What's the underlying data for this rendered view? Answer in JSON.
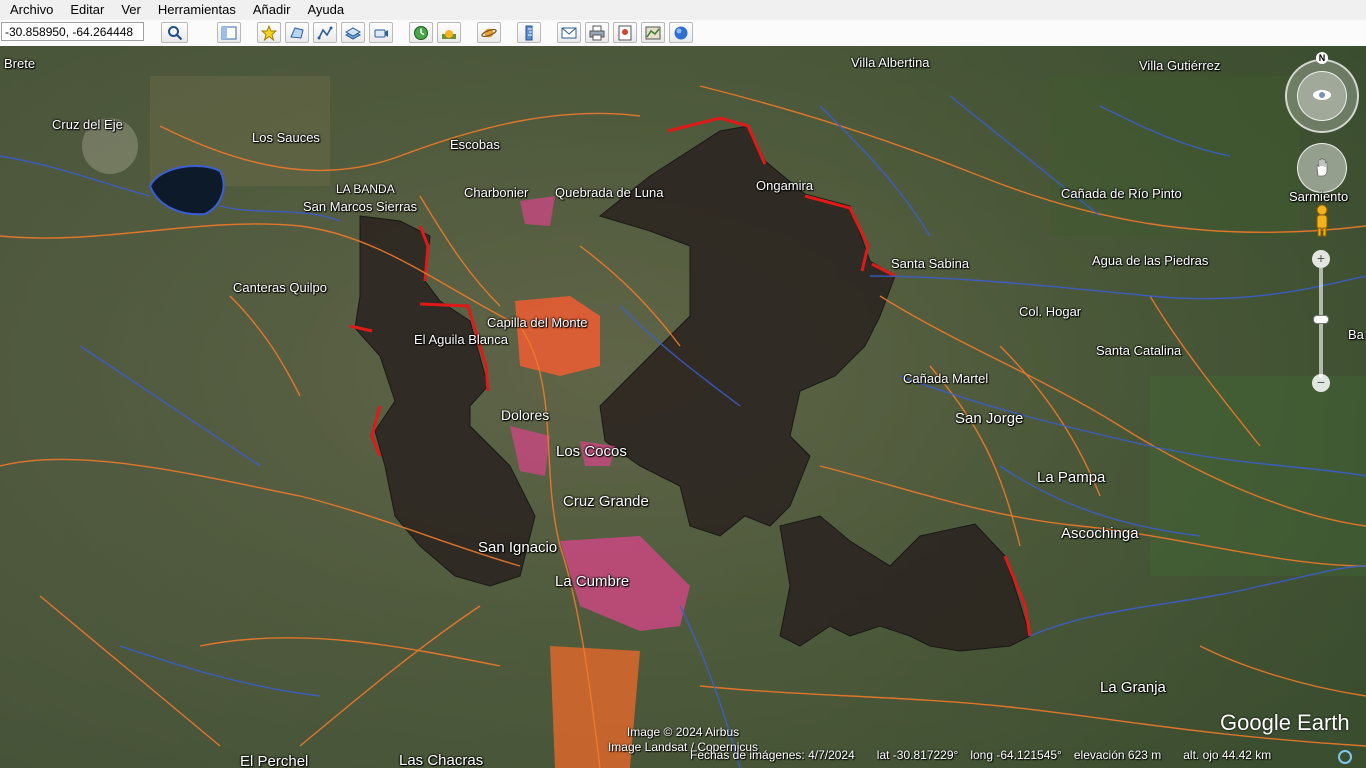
{
  "menu": [
    "Archivo",
    "Editar",
    "Ver",
    "Herramientas",
    "Añadir",
    "Ayuda"
  ],
  "search": {
    "value": "-30.858950, -64.264448"
  },
  "toolbar_icons": [
    "search-icon",
    "sidebar-toggle-icon",
    "placemark-icon",
    "polygon-icon",
    "path-icon",
    "overlay-icon",
    "tour-icon",
    "historical-imagery-icon",
    "sun-icon",
    "planets-icon",
    "ruler-icon",
    "email-icon",
    "print-icon",
    "save-image-icon",
    "google-maps-icon"
  ],
  "map_labels": {
    "brete": "Brete",
    "cruz_del_eje": "Cruz del Eje",
    "los_sauces": "Los Sauces",
    "escobas": "Escobas",
    "villa_albertina": "Villa Albertina",
    "villa_gutierrez": "Villa Gutiérrez",
    "la_banda": "LA BANDA",
    "san_marcos": "San Marcos Sierras",
    "charbonier": "Charbonier",
    "quebrada": "Quebrada de Luna",
    "ongamira": "Ongamira",
    "canada_rio_pinto": "Cañada de Río Pinto",
    "sarmiento": "Sarmiento",
    "santa_sabina": "Santa Sabina",
    "agua_piedras": "Agua de las Piedras",
    "canteras": "Canteras Quilpo",
    "col_hogar": "Col. Hogar",
    "capilla": "Capilla del Monte",
    "aguila": "El Aguila Blanca",
    "santa_catalina": "Santa Catalina",
    "ba": "Ba",
    "canada_martel": "Cañada Martel",
    "dolores": "Dolores",
    "san_jorge": "San Jorge",
    "los_cocos": "Los Cocos",
    "la_pampa": "La Pampa",
    "cruz_grande": "Cruz Grande",
    "ascochinga": "Ascochinga",
    "san_ignacio": "San Ignacio",
    "la_cumbre": "La Cumbre",
    "la_granja": "La Granja",
    "el_perchel": "El Perchel",
    "las_chacras": "Las Chacras"
  },
  "credits": [
    "Image © 2024 Airbus",
    "Image Landsat / Copernicus"
  ],
  "logo": "Google Earth",
  "status": {
    "date": "Fechas de imágenes: 4/7/2024",
    "lat": "lat  -30.817229°",
    "long": "long  -64.121545°",
    "elev": "elevación    623 m",
    "alt": "alt. ojo  44.42 km"
  },
  "compass": {
    "north": "N"
  },
  "colors": {
    "roads": "#f07a2a",
    "rivers": "#3a5fd6",
    "burn": "#2b2420",
    "perimeter": "#e01919",
    "urban": "#e0506a"
  }
}
